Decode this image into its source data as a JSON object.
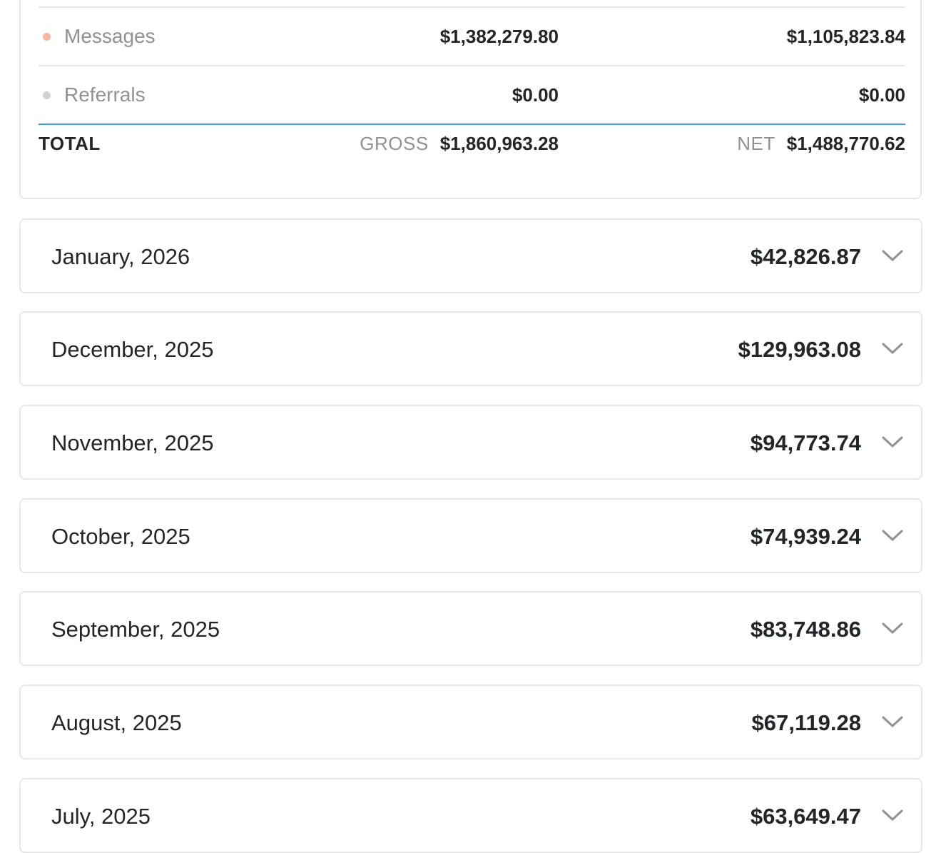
{
  "summary": {
    "rows": [
      {
        "label": "Messages",
        "dot_color": "#f4b8a1",
        "gross": "$1,382,279.80",
        "net": "$1,105,823.84"
      },
      {
        "label": "Referrals",
        "dot_color": "#cfd1d4",
        "gross": "$0.00",
        "net": "$0.00"
      }
    ],
    "total": {
      "label": "TOTAL",
      "gross_caption": "GROSS",
      "gross_value": "$1,860,963.28",
      "net_caption": "NET",
      "net_value": "$1,488,770.62"
    }
  },
  "months": [
    {
      "label": "January, 2026",
      "amount": "$42,826.87",
      "icon": "chevron-down-icon"
    },
    {
      "label": "December, 2025",
      "amount": "$129,963.08",
      "icon": "chevron-down-icon"
    },
    {
      "label": "November, 2025",
      "amount": "$94,773.74",
      "icon": "chevron-down-icon"
    },
    {
      "label": "October, 2025",
      "amount": "$74,939.24",
      "icon": "chevron-down-icon"
    },
    {
      "label": "September, 2025",
      "amount": "$83,748.86",
      "icon": "chevron-down-icon"
    },
    {
      "label": "August, 2025",
      "amount": "$67,119.28",
      "icon": "chevron-down-icon"
    },
    {
      "label": "July, 2025",
      "amount": "$63,649.47",
      "icon": "chevron-down-icon"
    }
  ],
  "colors": {
    "border": "#e6e8eb",
    "total_divider": "#3ea6dc",
    "muted_text": "#8e9196",
    "chevron": "#8e9196"
  }
}
